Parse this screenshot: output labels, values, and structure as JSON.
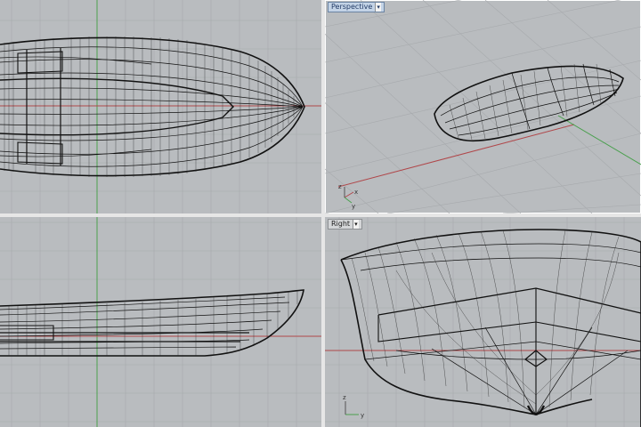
{
  "viewports": {
    "top": {
      "title": ""
    },
    "perspective": {
      "title": "Perspective",
      "menu_arrow": "▾"
    },
    "front": {
      "title": ""
    },
    "right": {
      "title": "Right",
      "menu_arrow": "▾"
    }
  },
  "axis_widget": {
    "persp_x": "x",
    "persp_y": "y",
    "persp_z": "z",
    "right_y": "y",
    "right_z": "z"
  },
  "colors": {
    "viewport_bg": "#b9bcbf",
    "grid_major": "#a6a9ac",
    "grid_minor": "#c3c6c8",
    "axis_x": "#b0474a",
    "axis_y": "#4aa04e",
    "wire": "#111111"
  },
  "icons": [
    "viewport-menu-arrow-icon",
    "axis-widget-icon"
  ]
}
